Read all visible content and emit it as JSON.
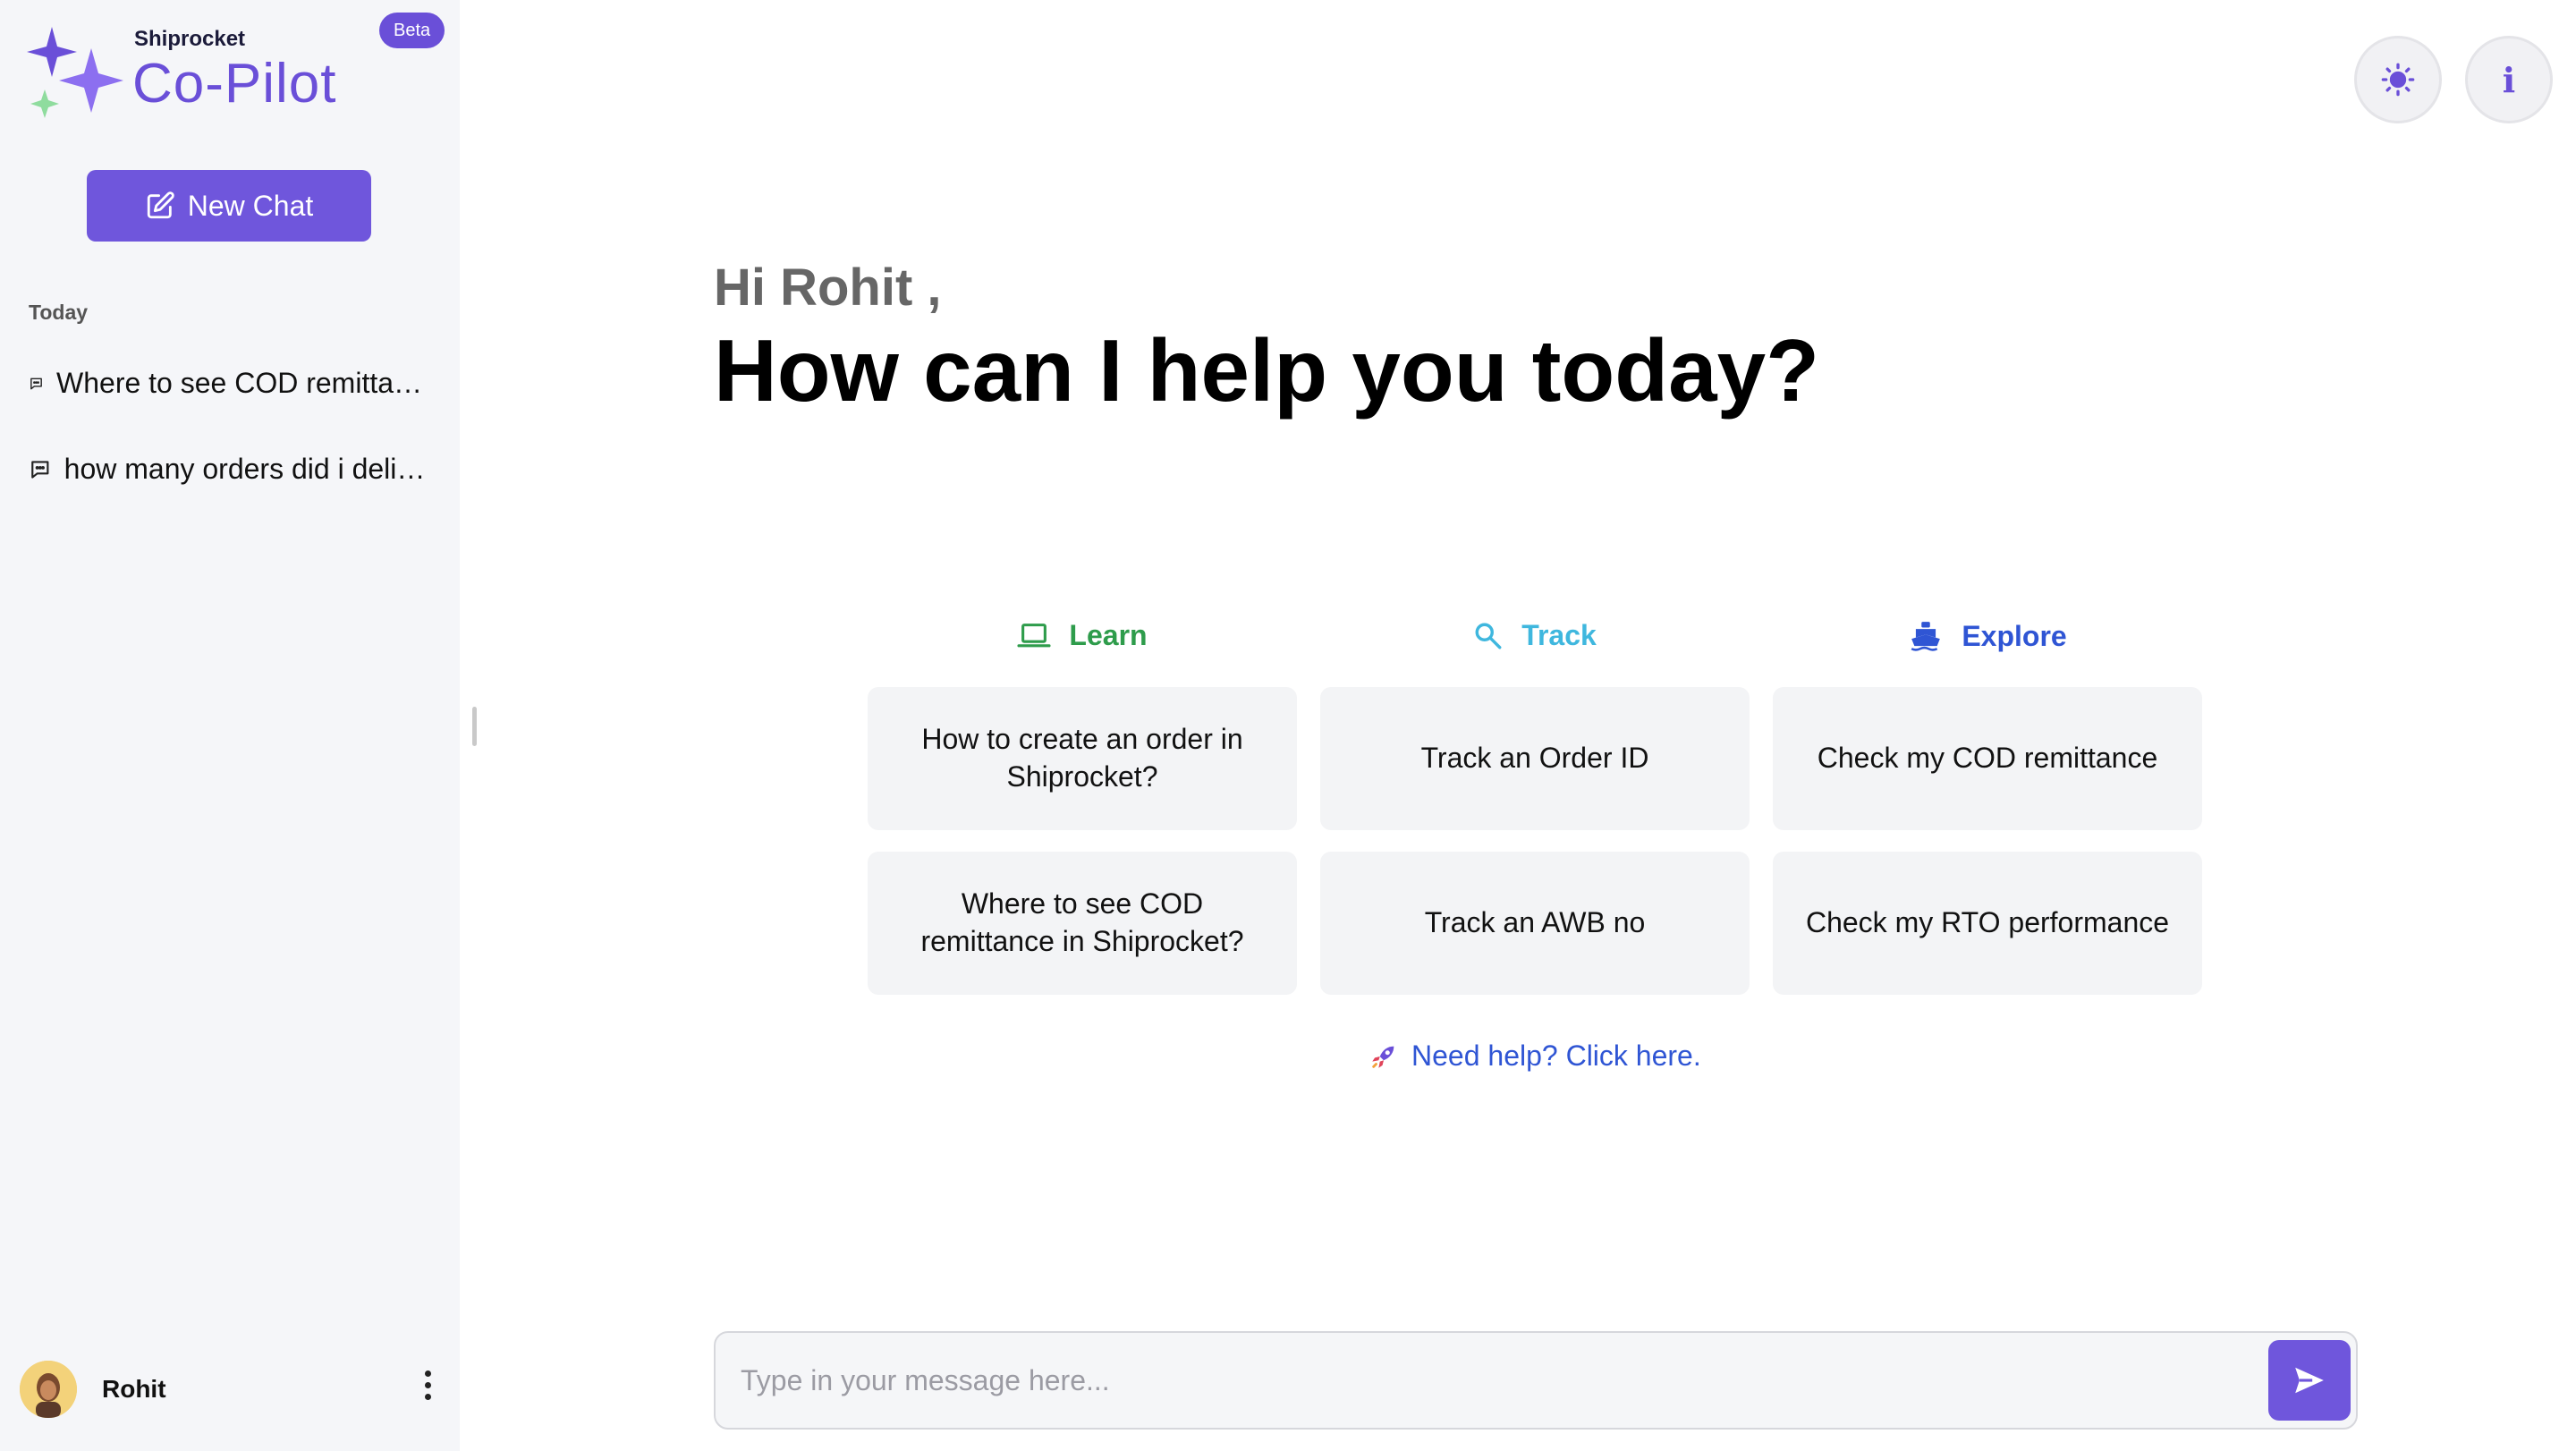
{
  "sidebar": {
    "brand_small": "Shiprocket",
    "brand_name": "Co-Pilot",
    "beta_label": "Beta",
    "new_chat_label": "New Chat",
    "section_label": "Today",
    "history": [
      {
        "label": "Where to see COD remittance in Shiprocket?"
      },
      {
        "label": "how many orders did i deliver"
      }
    ],
    "user_name": "Rohit"
  },
  "main": {
    "greeting": "Hi Rohit ,",
    "headline": "How can I help you today?",
    "categories": [
      {
        "label": "Learn",
        "icon": "laptop-icon",
        "color": "#2e9c4b"
      },
      {
        "label": "Track",
        "icon": "magnifier-icon",
        "color": "#3fb7de"
      },
      {
        "label": "Explore",
        "icon": "ship-icon",
        "color": "#2f55d4"
      }
    ],
    "cards": [
      {
        "label": "How to create an order in Shiprocket?"
      },
      {
        "label": "Track an Order ID"
      },
      {
        "label": "Check my COD remittance"
      },
      {
        "label": "Where to see COD remittance in Shiprocket?"
      },
      {
        "label": "Track an AWB no"
      },
      {
        "label": "Check my RTO performance"
      }
    ],
    "help_link": "Need help? Click here."
  },
  "input": {
    "placeholder": "Type in your message here...",
    "value": ""
  },
  "colors": {
    "accent": "#6f56dc",
    "sidebar_bg": "#f5f6f9"
  }
}
